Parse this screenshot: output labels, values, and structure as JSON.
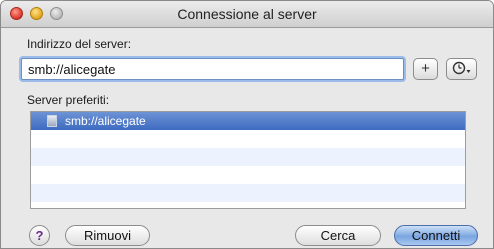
{
  "window": {
    "title": "Connessione al server"
  },
  "server_address": {
    "label": "Indirizzo del server:",
    "value": "smb://alicegate",
    "add_button_label": "+",
    "recent_icon": "clock-dropdown-icon"
  },
  "favorites": {
    "label": "Server preferiti:",
    "items": [
      {
        "label": "smb://alicegate",
        "icon": "server-icon",
        "selected": true
      }
    ]
  },
  "buttons": {
    "help_label": "?",
    "remove_label": "Rimuovi",
    "browse_label": "Cerca",
    "connect_label": "Connetti"
  },
  "colors": {
    "selection": "#3e6bc1",
    "default_button": "#7aa5e0",
    "focus_ring": "#9bbbea"
  }
}
